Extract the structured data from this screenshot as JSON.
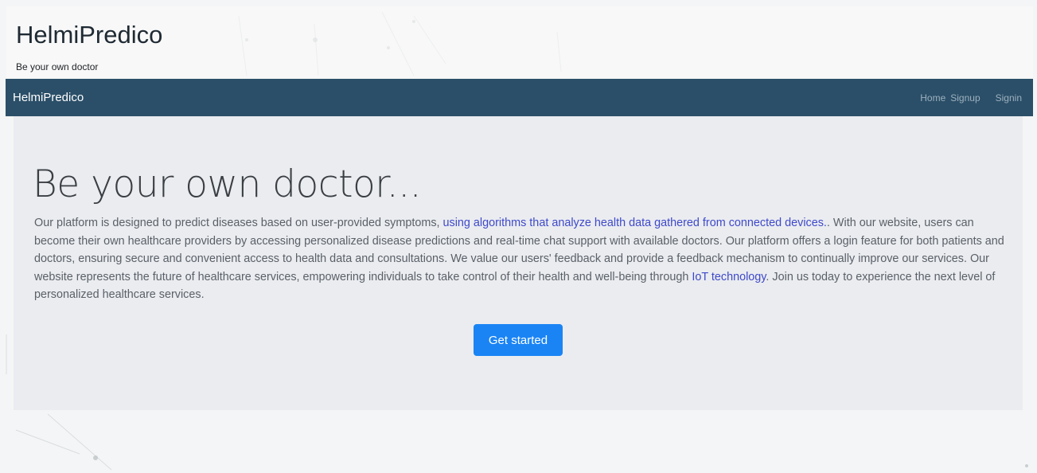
{
  "header": {
    "title": "HelmiPredico",
    "tagline": "Be your own doctor"
  },
  "navbar": {
    "brand": "HelmiPredico",
    "links": [
      {
        "label": "Home"
      },
      {
        "label": "Signup"
      },
      {
        "label": "Signin"
      }
    ],
    "background": "#2b4f68"
  },
  "hero": {
    "title": "Be your own doctor...",
    "text": {
      "part1": "Our platform is designed to predict diseases based on user-provided symptoms, ",
      "link1": "using algorithms that analyze health data gathered from connected devices.",
      "part2": ". With our website, users can become their own healthcare providers by accessing personalized disease predictions and real-time chat support with available doctors. Our platform offers a login feature for both patients and doctors, ensuring secure and convenient access to health data and consultations. We value our users' feedback and provide a feedback mechanism to continually improve our services. Our website represents the future of healthcare services, empowering individuals to take control of their health and well-being through ",
      "link2": "IoT technology",
      "part3": ". Join us today to experience the next level of personalized healthcare services."
    },
    "cta_label": "Get started",
    "accent": "#1a84f5",
    "highlight": "#3f49c9"
  }
}
